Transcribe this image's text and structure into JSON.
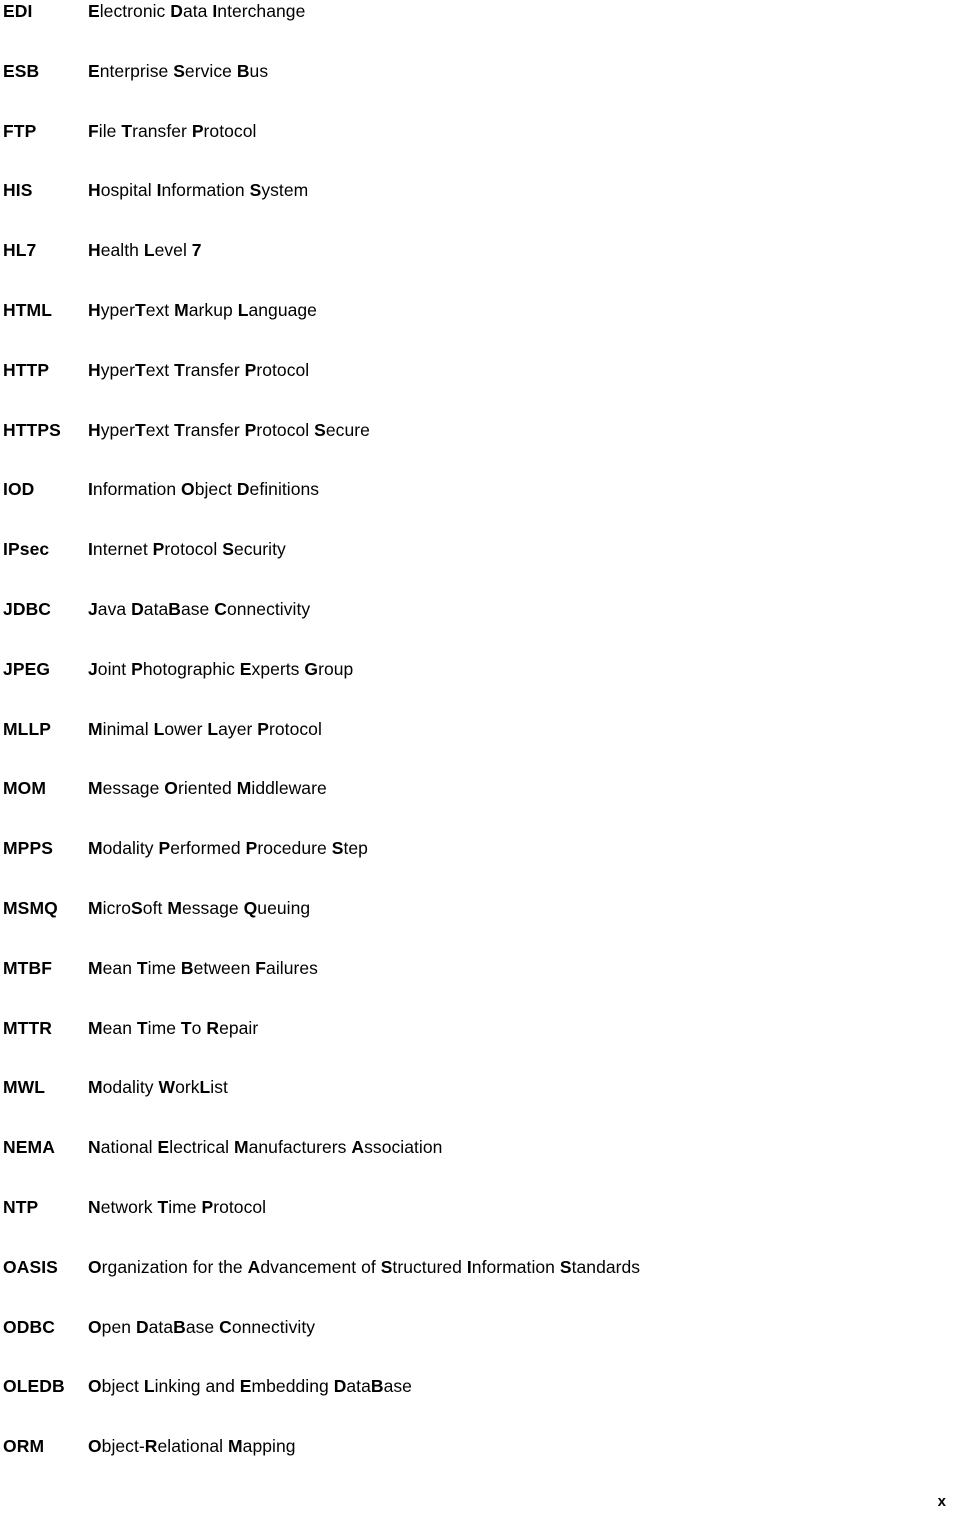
{
  "document": {
    "type": "glossary-acronym-list",
    "page_marker": "x",
    "column_headers_visible": false,
    "entries": [
      {
        "term": "EDI",
        "definition": "Electronic Data Interchange",
        "emphasis": [
          "E",
          "D",
          "I"
        ]
      },
      {
        "term": "ESB",
        "definition": "Enterprise Service Bus",
        "emphasis": [
          "E",
          "S",
          "B"
        ]
      },
      {
        "term": "FTP",
        "definition": "File Transfer Protocol",
        "emphasis": [
          "F",
          "T",
          "P"
        ]
      },
      {
        "term": "HIS",
        "definition": "Hospital Information System",
        "emphasis": [
          "H",
          "I",
          "S"
        ]
      },
      {
        "term": "HL7",
        "definition": "Health Level 7",
        "emphasis": [
          "H",
          "L",
          "7"
        ]
      },
      {
        "term": "HTML",
        "definition": "HyperText Markup Language",
        "emphasis": [
          "H",
          "T",
          "M",
          "L"
        ]
      },
      {
        "term": "HTTP",
        "definition": "HyperText Transfer Protocol",
        "emphasis": [
          "H",
          "T",
          "T",
          "P"
        ]
      },
      {
        "term": "HTTPS",
        "definition": "HyperText Transfer Protocol Secure",
        "emphasis": [
          "H",
          "T",
          "T",
          "P",
          "S"
        ]
      },
      {
        "term": "IOD",
        "definition": "Information Object Definitions",
        "emphasis": [
          "I",
          "O",
          "D"
        ]
      },
      {
        "term": "IPsec",
        "definition": "Internet Protocol Security",
        "emphasis": [
          "I",
          "P",
          "S"
        ]
      },
      {
        "term": "JDBC",
        "definition": "Java DataBase Connectivity",
        "emphasis": [
          "J",
          "D",
          "B",
          "C"
        ]
      },
      {
        "term": "JPEG",
        "definition": "Joint Photographic Experts Group",
        "emphasis": [
          "J",
          "P",
          "E",
          "G"
        ]
      },
      {
        "term": "MLLP",
        "definition": "Minimal Lower Layer Protocol",
        "emphasis": [
          "M",
          "L",
          "L",
          "P"
        ]
      },
      {
        "term": "MOM",
        "definition": "Message Oriented Middleware",
        "emphasis": [
          "M",
          "O",
          "M"
        ]
      },
      {
        "term": "MPPS",
        "definition": "Modality Performed Procedure Step",
        "emphasis": [
          "M",
          "P",
          "P",
          "S"
        ]
      },
      {
        "term": "MSMQ",
        "definition": "MicroSoft Message Queuing",
        "emphasis": [
          "M",
          "S",
          "M",
          "Q"
        ]
      },
      {
        "term": "MTBF",
        "definition": "Mean Time Between Failures",
        "emphasis": [
          "M",
          "T",
          "B",
          "F"
        ]
      },
      {
        "term": "MTTR",
        "definition": "Mean Time To Repair",
        "emphasis": [
          "M",
          "T",
          "T",
          "R"
        ]
      },
      {
        "term": "MWL",
        "definition": "Modality WorkList",
        "emphasis": [
          "M",
          "W",
          "L"
        ]
      },
      {
        "term": "NEMA",
        "definition": "National Electrical Manufacturers Association",
        "emphasis": [
          "N",
          "E",
          "M",
          "A"
        ]
      },
      {
        "term": "NTP",
        "definition": "Network Time Protocol",
        "emphasis": [
          "N",
          "T",
          "P"
        ]
      },
      {
        "term": "OASIS",
        "definition": "Organization for the Advancement of Structured Information Standards",
        "emphasis": [
          "O",
          "A",
          "S",
          "I",
          "S"
        ]
      },
      {
        "term": "ODBC",
        "definition": "Open DataBase Connectivity",
        "emphasis": [
          "O",
          "D",
          "B",
          "C"
        ]
      },
      {
        "term": "OLEDB",
        "definition": "Object Linking and Embedding DataBase",
        "emphasis": [
          "O",
          "L",
          "E",
          "D",
          "B"
        ]
      },
      {
        "term": "ORM",
        "definition": "Object-Relational Mapping",
        "emphasis": [
          "O",
          "R",
          "M"
        ]
      }
    ],
    "definition_markup": [
      "<b>E</b>lectronic <b>D</b>ata <b>I</b>nterchange",
      "<b>E</b>nterprise <b>S</b>ervice <b>B</b>us",
      "<b>F</b>ile <b>T</b>ransfer <b>P</b>rotocol",
      "<b>H</b>ospital <b>I</b>nformation <b>S</b>ystem",
      "<b>H</b>ealth <b>L</b>evel <b>7</b>",
      "<b>H</b>yper<b>T</b>ext <b>M</b>arkup <b>L</b>anguage",
      "<b>H</b>yper<b>T</b>ext <b>T</b>ransfer <b>P</b>rotocol",
      "<b>H</b>yper<b>T</b>ext <b>T</b>ransfer <b>P</b>rotocol <b>S</b>ecure",
      "<b>I</b>nformation <b>O</b>bject <b>D</b>efinitions",
      "<b>I</b>nternet <b>P</b>rotocol <b>S</b>ecurity",
      "<b>J</b>ava <b>D</b>ata<b>B</b>ase <b>C</b>onnectivity",
      "<b>J</b>oint <b>P</b>hotographic <b>E</b>xperts <b>G</b>roup",
      "<b>M</b>inimal <b>L</b>ower <b>L</b>ayer <b>P</b>rotocol",
      "<b>M</b>essage <b>O</b>riented <b>M</b>iddleware",
      "<b>M</b>odality <b>P</b>erformed <b>P</b>rocedure <b>S</b>tep",
      "<b>M</b>icro<b>S</b>oft <b>M</b>essage <b>Q</b>ueuing",
      "<b>M</b>ean <b>T</b>ime <b>B</b>etween <b>F</b>ailures",
      "<b>M</b>ean <b>T</b>ime <b>T</b>o <b>R</b>epair",
      "<b>M</b>odality <b>W</b>ork<b>L</b>ist",
      "<b>N</b>ational <b>E</b>lectrical <b>M</b>anufacturers <b>A</b>ssociation",
      "<b>N</b>etwork <b>T</b>ime <b>P</b>rotocol",
      "<b>O</b>rganization for the <b>A</b>dvancement of <b>S</b>tructured <b>I</b>nformation <b>S</b>tandards",
      "<b>O</b>pen <b>D</b>ata<b>B</b>ase <b>C</b>onnectivity",
      "<b>O</b>bject <b>L</b>inking and <b>E</b>mbedding <b>D</b>ata<b>B</b>ase",
      "<b>O</b>bject-<b>R</b>elational <b>M</b>apping"
    ]
  }
}
